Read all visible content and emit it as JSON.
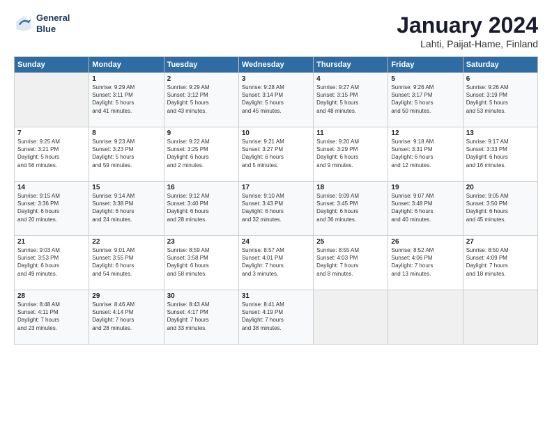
{
  "logo": {
    "line1": "General",
    "line2": "Blue"
  },
  "title": "January 2024",
  "subtitle": "Lahti, Paijat-Hame, Finland",
  "days_of_week": [
    "Sunday",
    "Monday",
    "Tuesday",
    "Wednesday",
    "Thursday",
    "Friday",
    "Saturday"
  ],
  "weeks": [
    [
      {
        "day": "",
        "info": ""
      },
      {
        "day": "1",
        "info": "Sunrise: 9:29 AM\nSunset: 3:11 PM\nDaylight: 5 hours\nand 41 minutes."
      },
      {
        "day": "2",
        "info": "Sunrise: 9:29 AM\nSunset: 3:12 PM\nDaylight: 5 hours\nand 43 minutes."
      },
      {
        "day": "3",
        "info": "Sunrise: 9:28 AM\nSunset: 3:14 PM\nDaylight: 5 hours\nand 45 minutes."
      },
      {
        "day": "4",
        "info": "Sunrise: 9:27 AM\nSunset: 3:15 PM\nDaylight: 5 hours\nand 48 minutes."
      },
      {
        "day": "5",
        "info": "Sunrise: 9:26 AM\nSunset: 3:17 PM\nDaylight: 5 hours\nand 50 minutes."
      },
      {
        "day": "6",
        "info": "Sunrise: 9:26 AM\nSunset: 3:19 PM\nDaylight: 5 hours\nand 53 minutes."
      }
    ],
    [
      {
        "day": "7",
        "info": "Sunrise: 9:25 AM\nSunset: 3:21 PM\nDaylight: 5 hours\nand 56 minutes."
      },
      {
        "day": "8",
        "info": "Sunrise: 9:23 AM\nSunset: 3:23 PM\nDaylight: 5 hours\nand 59 minutes."
      },
      {
        "day": "9",
        "info": "Sunrise: 9:22 AM\nSunset: 3:25 PM\nDaylight: 6 hours\nand 2 minutes."
      },
      {
        "day": "10",
        "info": "Sunrise: 9:21 AM\nSunset: 3:27 PM\nDaylight: 6 hours\nand 5 minutes."
      },
      {
        "day": "11",
        "info": "Sunrise: 9:20 AM\nSunset: 3:29 PM\nDaylight: 6 hours\nand 9 minutes."
      },
      {
        "day": "12",
        "info": "Sunrise: 9:18 AM\nSunset: 3:31 PM\nDaylight: 6 hours\nand 12 minutes."
      },
      {
        "day": "13",
        "info": "Sunrise: 9:17 AM\nSunset: 3:33 PM\nDaylight: 6 hours\nand 16 minutes."
      }
    ],
    [
      {
        "day": "14",
        "info": "Sunrise: 9:15 AM\nSunset: 3:36 PM\nDaylight: 6 hours\nand 20 minutes."
      },
      {
        "day": "15",
        "info": "Sunrise: 9:14 AM\nSunset: 3:38 PM\nDaylight: 6 hours\nand 24 minutes."
      },
      {
        "day": "16",
        "info": "Sunrise: 9:12 AM\nSunset: 3:40 PM\nDaylight: 6 hours\nand 28 minutes."
      },
      {
        "day": "17",
        "info": "Sunrise: 9:10 AM\nSunset: 3:43 PM\nDaylight: 6 hours\nand 32 minutes."
      },
      {
        "day": "18",
        "info": "Sunrise: 9:09 AM\nSunset: 3:45 PM\nDaylight: 6 hours\nand 36 minutes."
      },
      {
        "day": "19",
        "info": "Sunrise: 9:07 AM\nSunset: 3:48 PM\nDaylight: 6 hours\nand 40 minutes."
      },
      {
        "day": "20",
        "info": "Sunrise: 9:05 AM\nSunset: 3:50 PM\nDaylight: 6 hours\nand 45 minutes."
      }
    ],
    [
      {
        "day": "21",
        "info": "Sunrise: 9:03 AM\nSunset: 3:53 PM\nDaylight: 6 hours\nand 49 minutes."
      },
      {
        "day": "22",
        "info": "Sunrise: 9:01 AM\nSunset: 3:55 PM\nDaylight: 6 hours\nand 54 minutes."
      },
      {
        "day": "23",
        "info": "Sunrise: 8:59 AM\nSunset: 3:58 PM\nDaylight: 6 hours\nand 58 minutes."
      },
      {
        "day": "24",
        "info": "Sunrise: 8:57 AM\nSunset: 4:01 PM\nDaylight: 7 hours\nand 3 minutes."
      },
      {
        "day": "25",
        "info": "Sunrise: 8:55 AM\nSunset: 4:03 PM\nDaylight: 7 hours\nand 8 minutes."
      },
      {
        "day": "26",
        "info": "Sunrise: 8:52 AM\nSunset: 4:06 PM\nDaylight: 7 hours\nand 13 minutes."
      },
      {
        "day": "27",
        "info": "Sunrise: 8:50 AM\nSunset: 4:09 PM\nDaylight: 7 hours\nand 18 minutes."
      }
    ],
    [
      {
        "day": "28",
        "info": "Sunrise: 8:48 AM\nSunset: 4:11 PM\nDaylight: 7 hours\nand 23 minutes."
      },
      {
        "day": "29",
        "info": "Sunrise: 8:46 AM\nSunset: 4:14 PM\nDaylight: 7 hours\nand 28 minutes."
      },
      {
        "day": "30",
        "info": "Sunrise: 8:43 AM\nSunset: 4:17 PM\nDaylight: 7 hours\nand 33 minutes."
      },
      {
        "day": "31",
        "info": "Sunrise: 8:41 AM\nSunset: 4:19 PM\nDaylight: 7 hours\nand 38 minutes."
      },
      {
        "day": "",
        "info": ""
      },
      {
        "day": "",
        "info": ""
      },
      {
        "day": "",
        "info": ""
      }
    ]
  ]
}
